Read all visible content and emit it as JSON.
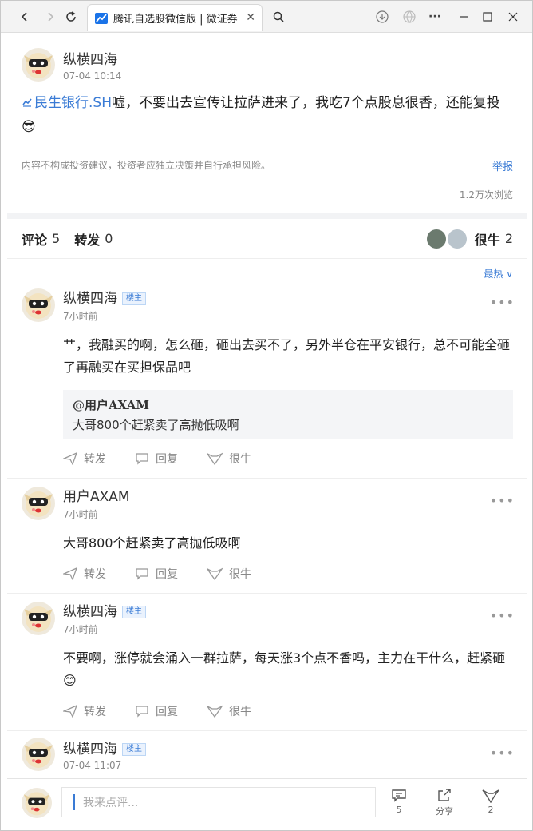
{
  "browser": {
    "tab_title": "腾讯自选股微信版 | 微证券"
  },
  "post": {
    "author": "纵横四海",
    "time": "07-04 10:14",
    "stock_link": "民生银行.SH",
    "text": "嘘，不要出去宣传让拉萨进来了，我吃7个点股息很香，还能复投😎",
    "disclaimer": "内容不构成投资建议，投资者应独立决策并自行承担风险。",
    "report": "举报",
    "views": "1.2万次浏览"
  },
  "stats": {
    "comment_label": "评论",
    "comment_count": "5",
    "repost_label": "转发",
    "repost_count": "0",
    "like_label": "很牛",
    "like_count": "2"
  },
  "sort": "最热",
  "comments": [
    {
      "author": "纵横四海",
      "badge": "楼主",
      "time": "7小时前",
      "text": "艹，我融买的啊，怎么砸，砸出去买不了，另外半仓在平安银行，总不可能全砸了再融买在买担保品吧",
      "quote_author": "@用户AXAM",
      "quote_text": "大哥800个赶紧卖了高抛低吸啊"
    },
    {
      "author": "用户AXAM",
      "time": "7小时前",
      "text": "大哥800个赶紧卖了高抛低吸啊"
    },
    {
      "author": "纵横四海",
      "badge": "楼主",
      "time": "7小时前",
      "text": "不要啊，涨停就会涌入一群拉萨，每天涨3个点不香吗，主力在干什么，赶紧砸😊"
    },
    {
      "author": "纵横四海",
      "badge": "楼主",
      "time": "07-04 11:07"
    }
  ],
  "actions": {
    "repost": "转发",
    "reply": "回复",
    "like": "很牛"
  },
  "bottom": {
    "placeholder": "我来点评...",
    "comment_count": "5",
    "share": "分享",
    "like_count": "2"
  }
}
